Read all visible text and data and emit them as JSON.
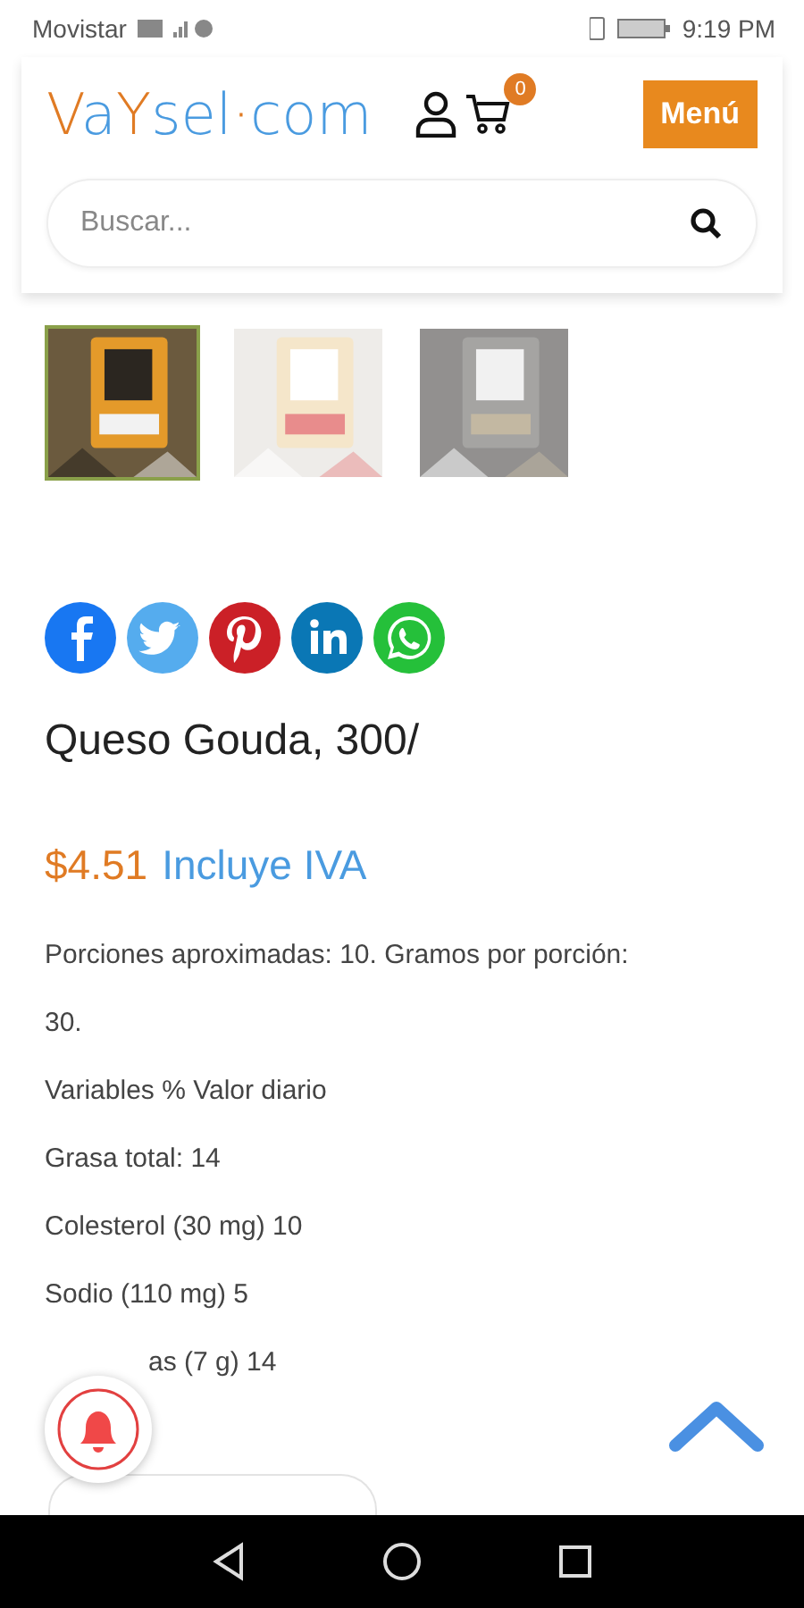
{
  "status_bar": {
    "carrier": "Movistar",
    "time": "9:19 PM"
  },
  "header": {
    "logo": [
      {
        "text": "V",
        "color": "#e07b24"
      },
      {
        "text": "a",
        "color": "#4a9be0"
      },
      {
        "text": "Y",
        "color": "#e07b24"
      },
      {
        "text": "sel",
        "color": "#4a9be0"
      },
      {
        "text": "·",
        "color": "#e07b24"
      },
      {
        "text": "com",
        "color": "#4a9be0"
      }
    ],
    "cart_count": "0",
    "menu_button": "Menú",
    "search": {
      "placeholder": "Buscar..."
    }
  },
  "gallery": [
    {
      "kind": "picture",
      "selected": true
    },
    {
      "kind": "picture",
      "selected": false
    },
    {
      "kind": "picture",
      "selected": false
    }
  ],
  "share": [
    {
      "kind": "facebook"
    },
    {
      "kind": "twitter"
    },
    {
      "kind": "pinterest"
    },
    {
      "kind": "linkedin"
    },
    {
      "kind": "whatsapp"
    }
  ],
  "product": {
    "title": "Queso Gouda, 300/",
    "price": "$4.51",
    "tax_note": "Incluye IVA",
    "details": [
      "Porciones aproximadas: 10. Gramos por porción:",
      "30.",
      "Variables % Valor diario",
      "Grasa total: 14",
      "Colesterol (30 mg) 10",
      "Sodio (110 mg) 5"
    ],
    "covered_line": "as (7 g) 14"
  }
}
